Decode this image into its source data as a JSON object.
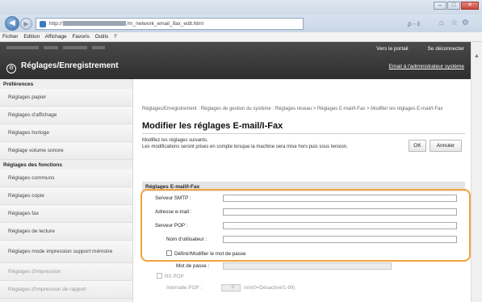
{
  "browser": {
    "url_prefix": "http://",
    "url_suffix": "/m_network_email_ifax_edit.html",
    "search": "ρ - ċ",
    "menu": [
      "Fichier",
      "Edition",
      "Affichage",
      "Favoris",
      "Outils",
      "?"
    ]
  },
  "header": {
    "title": "Réglages/Enregistrement",
    "portal_link": "Vers le portail",
    "logout_link": "Se déconnecter",
    "email_admin_link": "Email à l'administrateur système"
  },
  "sidebar": {
    "group1_title": "Préférences",
    "group1_items": [
      "Réglages papier",
      "Réglages d'affichage",
      "Réglages horloge",
      "Réglage volume sonore"
    ],
    "group2_title": "Réglages des fonctions",
    "group2_items": [
      "Réglages communs",
      "Réglages copie",
      "Réglages fax",
      "Réglages de lecture",
      "Réglages mode impression support mémoire",
      "Réglages d'impression",
      "Réglages d'impression de rapport"
    ]
  },
  "main": {
    "breadcrumb": "Réglages/Enregistrement : Réglages de gestion du système : Réglages réseau > Réglages E-mail/I-Fax > Modifier les réglages E-mail/I-Fax",
    "title": "Modifier les réglages E-mail/I-Fax",
    "desc_line1": "Modifiez les réglages suivants.",
    "desc_line2": "Les modifications seront prises en compte lorsque la machine sera mise hors puis sous tension.",
    "ok_label": "OK",
    "cancel_label": "Annuler",
    "section_title": "Réglages E-mail/I-Fax",
    "smtp_label": "Serveur SMTP :",
    "email_label": "Adresse e-mail :",
    "pop_label": "Serveur POP :",
    "username_label": "Nom d'utilisateur :",
    "password_checkbox_label": "Définir/Modifier le mot de passe",
    "password_label": "Mot de passe :",
    "rxpop_label": "RX POP",
    "interval_label": "Intervalle POP :",
    "interval_value": "0",
    "interval_unit": "min(0=Désactivé/1-99)"
  }
}
